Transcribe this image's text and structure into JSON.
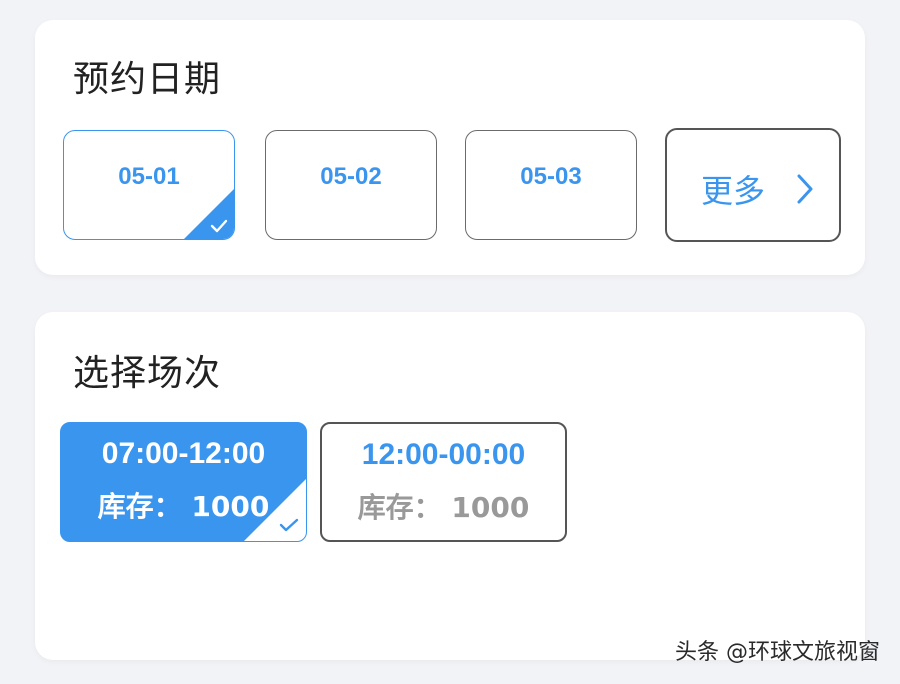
{
  "date_section": {
    "title": "预约日期",
    "dates": [
      {
        "label": "05-01",
        "selected": true
      },
      {
        "label": "05-02",
        "selected": false
      },
      {
        "label": "05-03",
        "selected": false
      }
    ],
    "more_label": "更多"
  },
  "session_section": {
    "title": "选择场次",
    "sessions": [
      {
        "time": "07:00-12:00",
        "stock": "库存： 1000",
        "selected": true
      },
      {
        "time": "12:00-00:00",
        "stock": "库存： 1000",
        "selected": false
      }
    ]
  },
  "watermark": "头条 @环球文旅视窗",
  "colors": {
    "accent": "#3a95ef",
    "background": "#f2f3f7",
    "card": "#ffffff",
    "border": "#555555",
    "muted_text": "#999999"
  },
  "icons": {
    "selected_check": "check-icon",
    "more_arrow": "chevron-right-icon"
  }
}
